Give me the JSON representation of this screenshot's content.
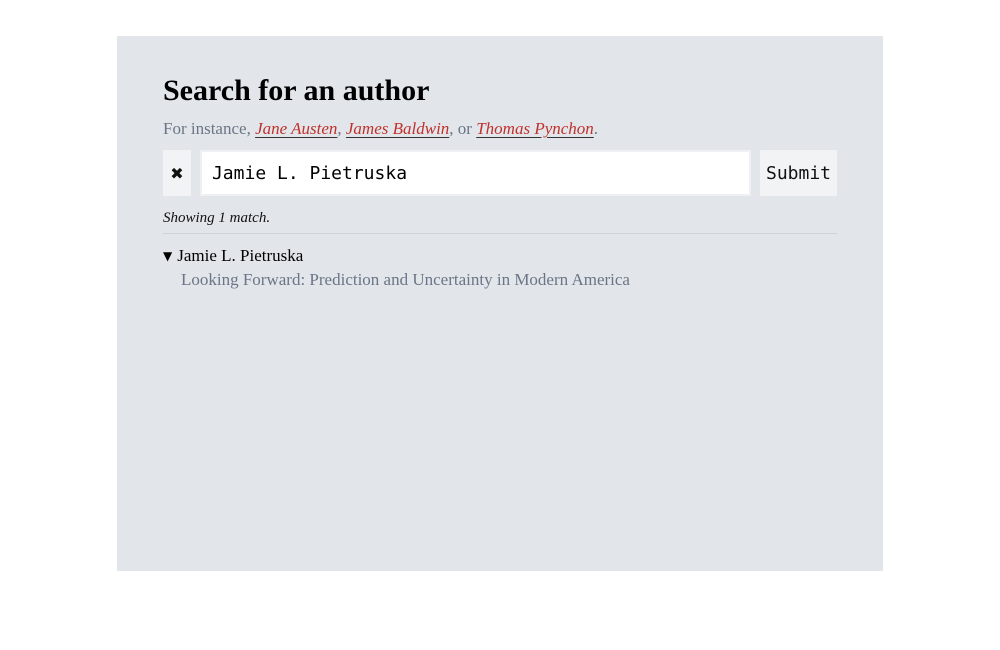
{
  "heading": "Search for an author",
  "hint": {
    "prefix": "For instance,",
    "examples": [
      "Jane Austen",
      "James Baldwin",
      "Thomas Pynchon"
    ],
    "sep1": ",",
    "sep2": ", or",
    "suffix": "."
  },
  "search": {
    "clear_icon": "✖",
    "value": "Jamie L. Pietruska",
    "submit_label": "Submit"
  },
  "results": {
    "count_text": "Showing 1 match.",
    "items": [
      {
        "expander_icon": "▼",
        "author": "Jamie L. Pietruska",
        "books": [
          "Looking Forward: Prediction and Uncertainty in Modern America"
        ]
      }
    ]
  },
  "colors": {
    "panel_bg": "#e2e6eb",
    "link": "#c0312b",
    "muted_text": "#6b7585"
  }
}
